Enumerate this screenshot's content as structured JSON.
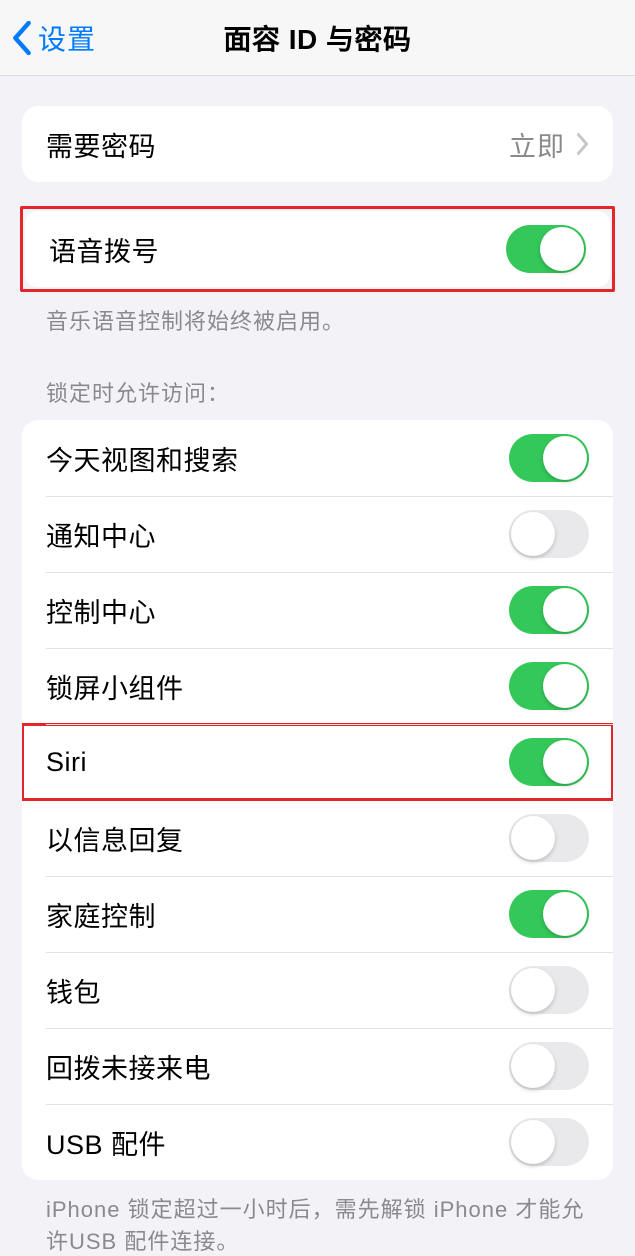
{
  "navbar": {
    "back_label": "设置",
    "title": "面容 ID 与密码"
  },
  "require_passcode": {
    "label": "需要密码",
    "value": "立即"
  },
  "voice_dial": {
    "label": "语音拨号",
    "footer": "音乐语音控制将始终被启用。"
  },
  "lock_access": {
    "header": "锁定时允许访问：",
    "items": [
      {
        "label": "今天视图和搜索",
        "on": true
      },
      {
        "label": "通知中心",
        "on": false
      },
      {
        "label": "控制中心",
        "on": true
      },
      {
        "label": "锁屏小组件",
        "on": true
      },
      {
        "label": "Siri",
        "on": true
      },
      {
        "label": "以信息回复",
        "on": false
      },
      {
        "label": "家庭控制",
        "on": true
      },
      {
        "label": "钱包",
        "on": false
      },
      {
        "label": "回拨未接来电",
        "on": false
      },
      {
        "label": "USB 配件",
        "on": false
      }
    ],
    "footer": "iPhone 锁定超过一小时后，需先解锁 iPhone 才能允许USB 配件连接。"
  }
}
